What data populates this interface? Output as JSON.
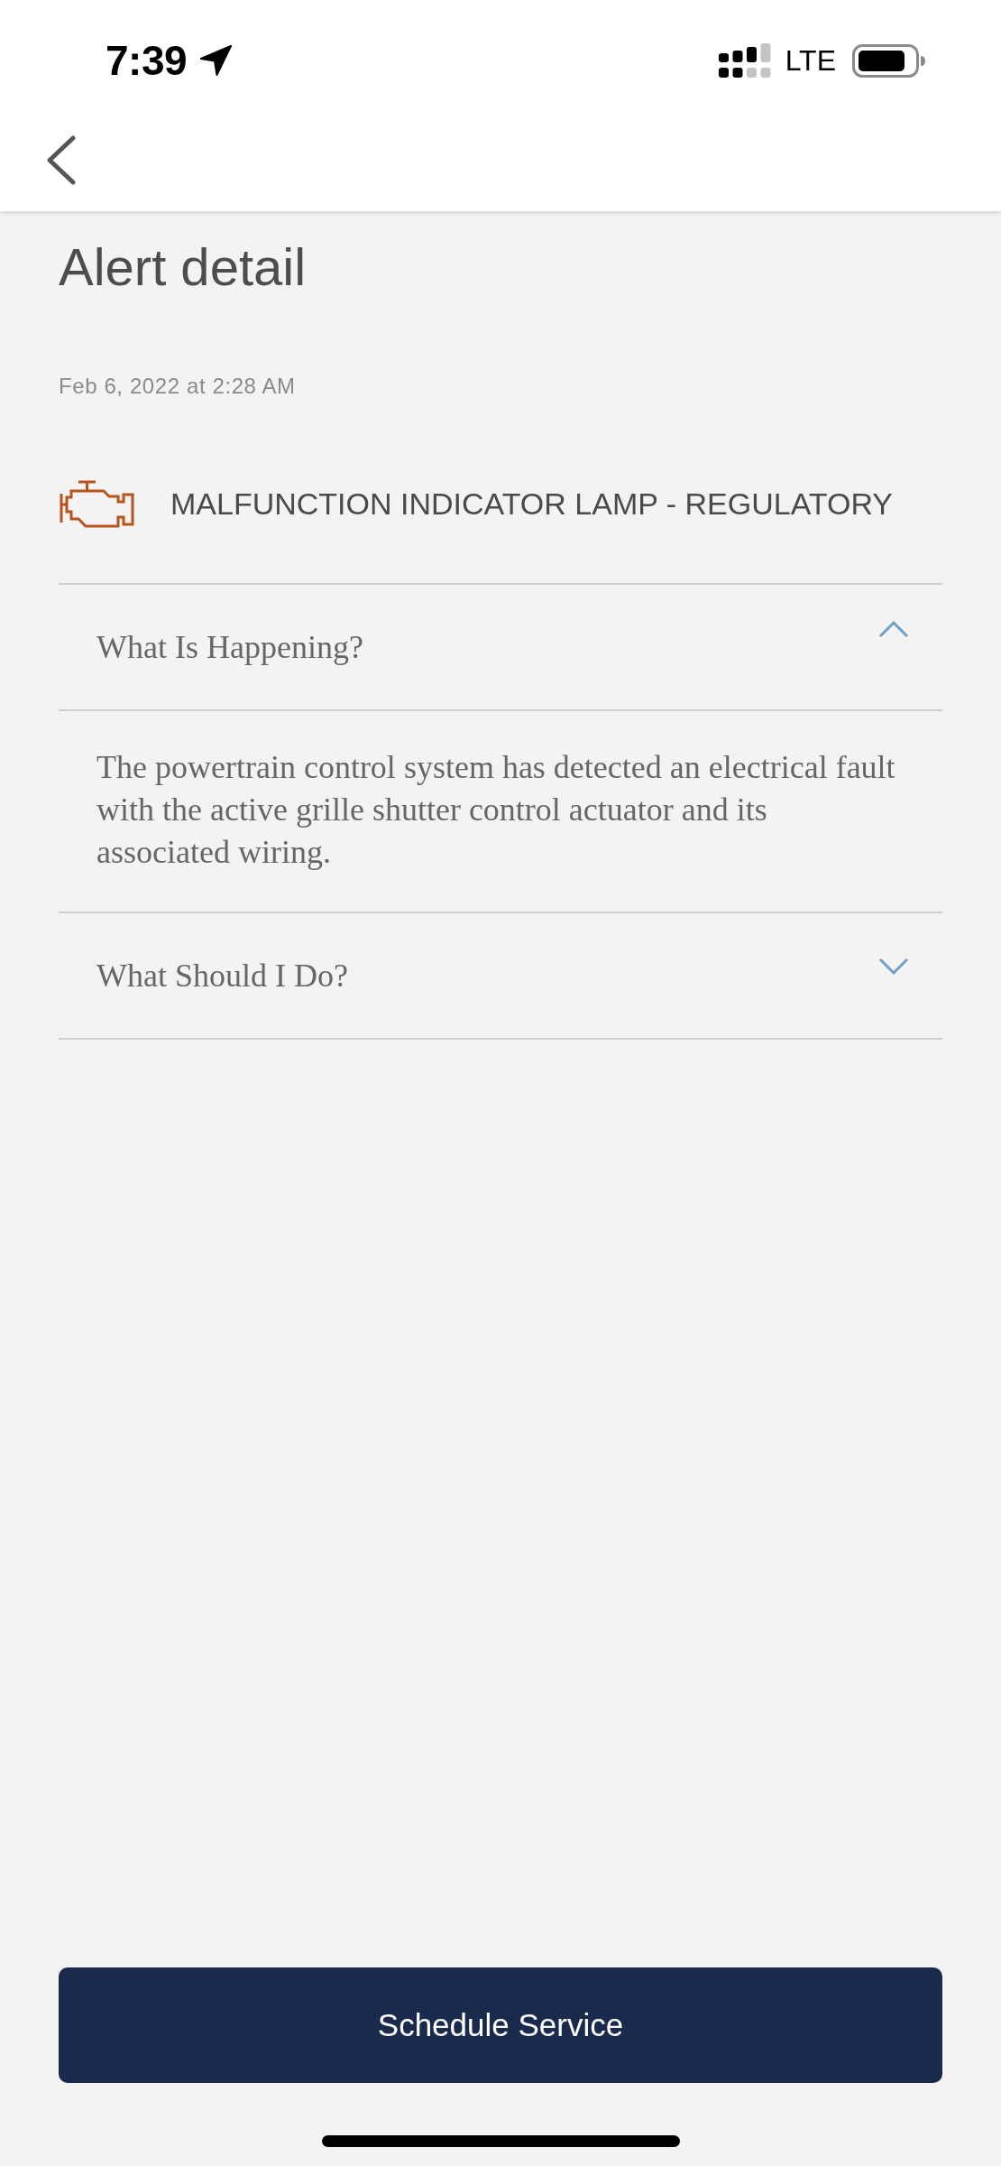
{
  "status_bar": {
    "time": "7:39",
    "network": "LTE"
  },
  "page": {
    "title": "Alert detail",
    "timestamp": "Feb 6, 2022 at 2:28 AM"
  },
  "alert": {
    "title": "MALFUNCTION INDICATOR LAMP - REGULATORY"
  },
  "sections": [
    {
      "heading": "What Is Happening?",
      "expanded": true,
      "body": "The powertrain control system has detected an electrical fault with the active grille shutter control actuator and its associated wiring."
    },
    {
      "heading": "What Should I Do?",
      "expanded": false
    }
  ],
  "action_button": {
    "label": "Schedule Service"
  }
}
